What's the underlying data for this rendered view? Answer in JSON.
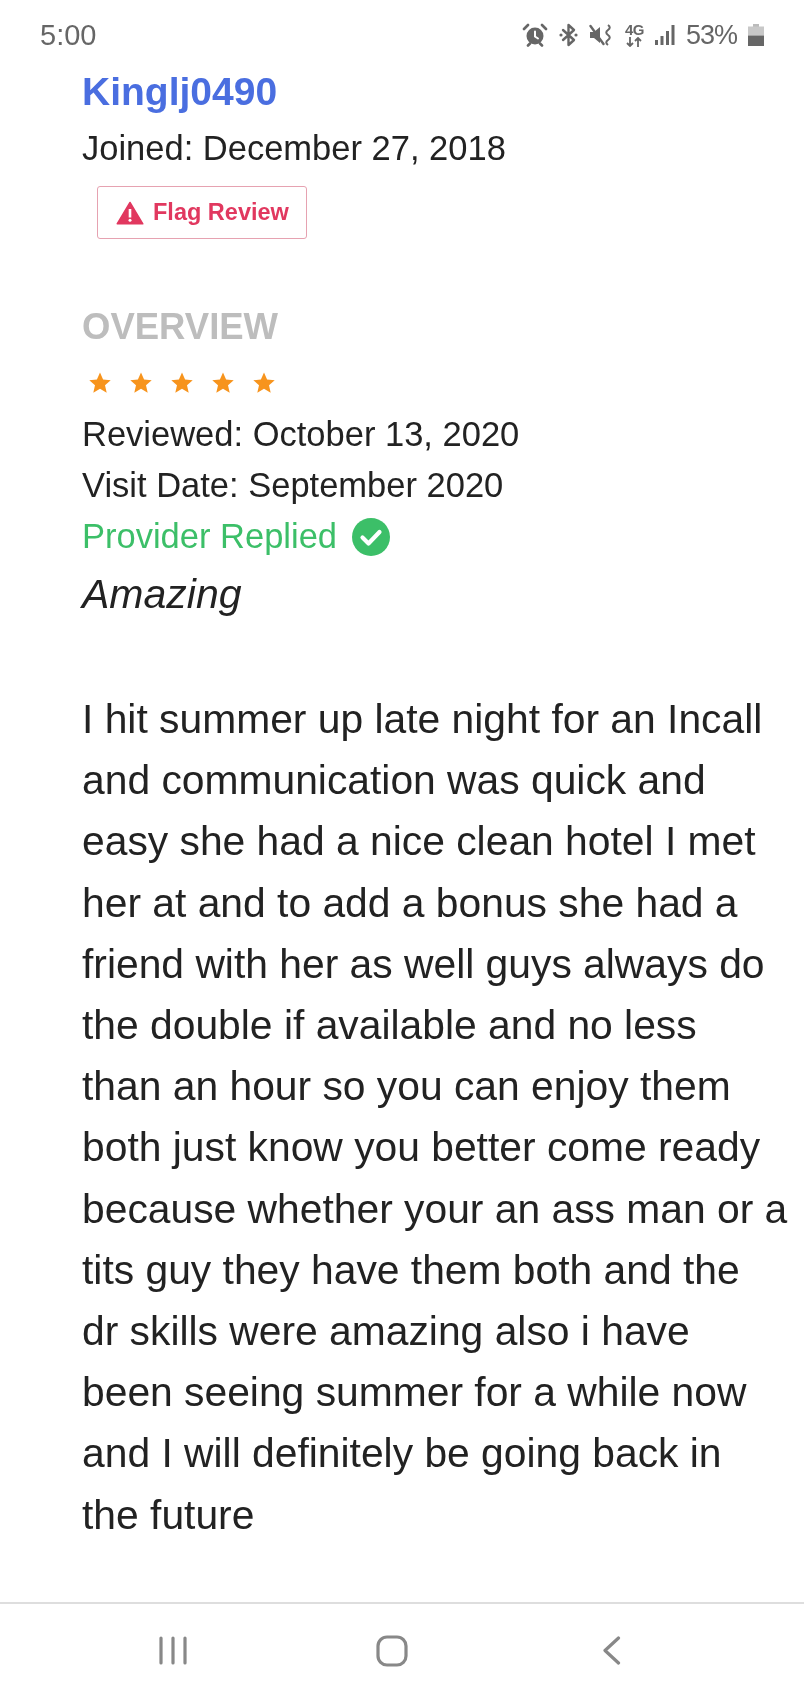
{
  "status_bar": {
    "time": "5:00",
    "network": "4G",
    "battery": "53%"
  },
  "reviewer": {
    "name": "Kinglj0490",
    "joined": "Joined: December 27, 2018"
  },
  "flag_button": {
    "label": "Flag Review"
  },
  "overview": {
    "heading": "OVERVIEW",
    "stars": 5,
    "reviewed": "Reviewed: October 13, 2020",
    "visit_date": "Visit Date: September 2020",
    "provider_replied": "Provider Replied"
  },
  "review": {
    "title": "Amazing",
    "body": "I hit summer up late night for an Incall\nand communication was quick and\neasy she had a nice clean hotel I met\nher at and to add a bonus she had a\nfriend with her as well guys always do\nthe double if available and no less\nthan an hour so you can enjoy them\nboth just know you better come ready\nbecause whether your an ass man or a\ntits guy they have them both and the\ndr skills were amazing also i have\nbeen seeing summer for a while now\nand I will definitely be going back in\nthe future"
  }
}
